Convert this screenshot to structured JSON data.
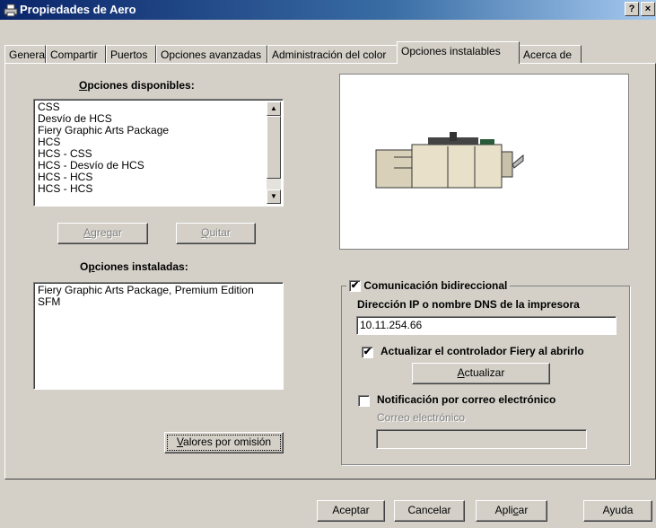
{
  "window": {
    "title": "Propiedades de Aero",
    "help_btn": "?",
    "close_btn": "×"
  },
  "tabs": [
    {
      "label": "General"
    },
    {
      "label": "Compartir"
    },
    {
      "label": "Puertos"
    },
    {
      "label": "Opciones avanzadas"
    },
    {
      "label": "Administración del color"
    },
    {
      "label": "Opciones instalables"
    },
    {
      "label": "Acerca de"
    }
  ],
  "active_tab": "Opciones instalables",
  "available": {
    "label_prefix": "",
    "label_key": "O",
    "label_rest": "pciones disponibles:",
    "items": [
      "CSS",
      "Desvío de HCS",
      "Fiery Graphic Arts Package",
      "HCS",
      "HCS - CSS",
      "HCS - Desvío de HCS",
      "HCS - HCS",
      "HCS - HCS"
    ]
  },
  "buttons": {
    "add_key": "A",
    "add_rest": "gregar",
    "remove_key": "Q",
    "remove_rest": "uitar",
    "defaults_key": "V",
    "defaults_rest": "alores por omisión",
    "update_key": "A",
    "update_rest": "ctualizar"
  },
  "installed": {
    "label_prefix": "O",
    "label_key": "p",
    "label_rest": "ciones instaladas:",
    "items": [
      "Fiery Graphic Arts Package, Premium Edition",
      "SFM"
    ]
  },
  "bidi": {
    "checkbox_label": "Comunicación bidireccional",
    "checked": true,
    "ip_label": "Dirección IP o nombre DNS de la impresora",
    "ip_value": "10.11.254.66",
    "update_driver_label": "Actualizar el controlador Fiery al abrirlo",
    "update_driver_checked": true,
    "email_notify_label": "Notificación por correo electrónico",
    "email_notify_checked": false,
    "email_label": "Correo electrónico",
    "email_value": ""
  },
  "footer": {
    "ok": "Aceptar",
    "cancel": "Cancelar",
    "apply_prefix": "Apli",
    "apply_key": "c",
    "apply_rest": "ar",
    "help": "Ayuda"
  }
}
